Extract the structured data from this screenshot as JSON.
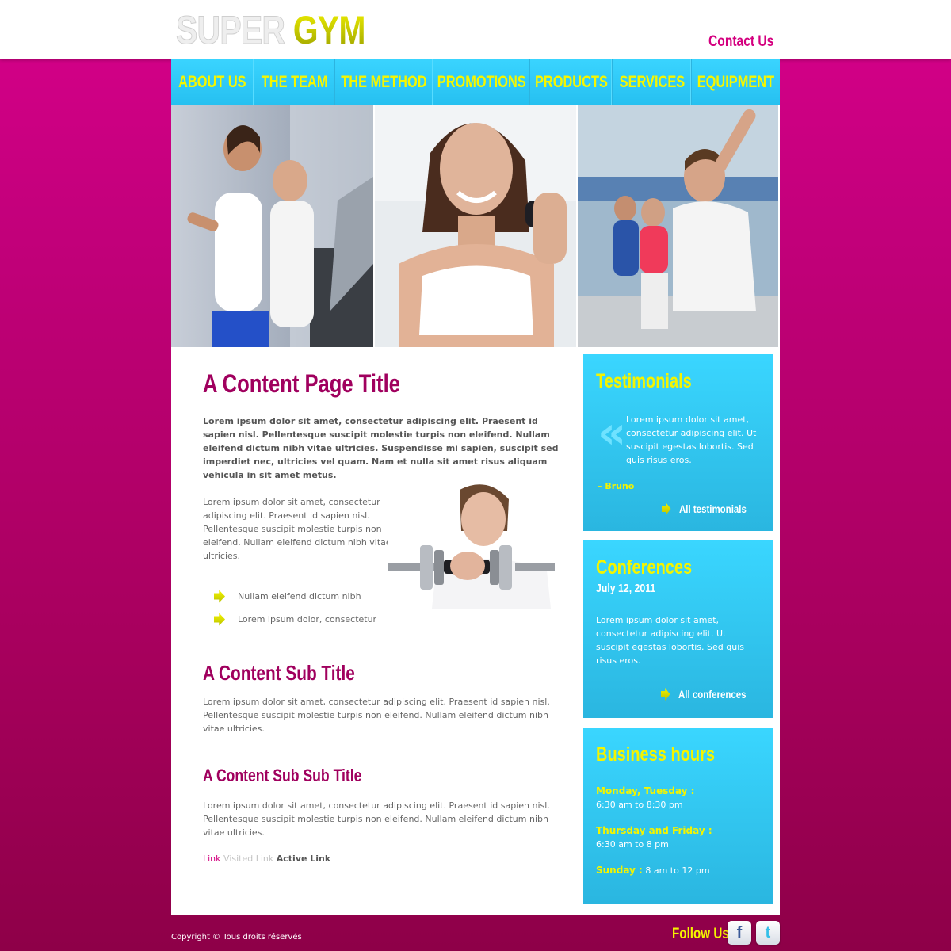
{
  "header": {
    "logo_part1": "SUPER",
    "logo_part2": "GYM",
    "contact_label": "Contact Us"
  },
  "nav": {
    "items": [
      {
        "label": "ABOUT US"
      },
      {
        "label": "THE TEAM"
      },
      {
        "label": "THE METHOD"
      },
      {
        "label": "PROMOTIONS"
      },
      {
        "label": "PRODUCTS"
      },
      {
        "label": "SERVICES"
      },
      {
        "label": "EQUIPMENT"
      }
    ]
  },
  "content": {
    "page_title": "A Content Page Title",
    "lead": "Lorem ipsum dolor sit amet, consectetur adipiscing elit. Praesent id sapien nisl. Pellentesque suscipit molestie turpis non eleifend. Nullam eleifend dictum nibh vitae ultricies. Suspendisse mi sapien, suscipit sed imperdiet nec, ultricies vel quam. Nam et nulla sit amet risus aliquam vehicula in sit amet metus.",
    "intro": "Lorem ipsum dolor sit amet, consectetur adipiscing elit. Praesent id sapien nisl. Pellentesque suscipit molestie turpis non eleifend. Nullam eleifend dictum nibh vitae ultricies.",
    "bullets": [
      "Nullam eleifend dictum nibh",
      "Lorem ipsum dolor, consectetur"
    ],
    "sub_title": "A Content Sub Title",
    "sub_text": "Lorem ipsum dolor sit amet, consectetur adipiscing elit. Praesent id sapien nisl. Pellentesque suscipit molestie turpis non eleifend. Nullam eleifend dictum nibh vitae ultricies.",
    "sub_sub_title": "A Content Sub Sub Title",
    "sub_sub_text": "Lorem ipsum dolor sit amet, consectetur adipiscing elit. Praesent id sapien nisl. Pellentesque suscipit molestie turpis non eleifend. Nullam eleifend dictum nibh vitae ultricies.",
    "link_label": "Link",
    "visited_label": "Visited Link",
    "active_label": "Active Link"
  },
  "testimonials": {
    "title": "Testimonials",
    "text": "Lorem ipsum dolor sit amet, consectetur adipiscing elit. Ut suscipit egestas lobortis. Sed quis risus eros.",
    "author": "– Bruno",
    "more": "All testimonials"
  },
  "conferences": {
    "title": "Conferences",
    "date": "July 12, 2011",
    "text": "Lorem ipsum dolor sit amet, consectetur adipiscing elit. Ut suscipit egestas lobortis. Sed quis risus eros.",
    "more": "All conferences"
  },
  "hours": {
    "title": "Business hours",
    "day1": "Monday, Tuesday :",
    "time1": "6:30 am to 8:30 pm",
    "day2": "Thursday and Friday :",
    "time2": "6:30 am to 8 pm",
    "day3": "Sunday :",
    "time3": "8 am to 12 pm"
  },
  "footer": {
    "copyright": "Copyright © Tous droits réservés",
    "follow": "Follow Us",
    "facebook_glyph": "f",
    "twitter_glyph": "t"
  },
  "colors": {
    "accent_pink": "#d4007f",
    "title_magenta": "#a0005e",
    "nav_cyan": "#2ccaf8",
    "accent_yellow": "#f4f400"
  },
  "icons": [
    "quote-icon",
    "arrow-right-icon",
    "facebook-icon",
    "twitter-icon"
  ]
}
